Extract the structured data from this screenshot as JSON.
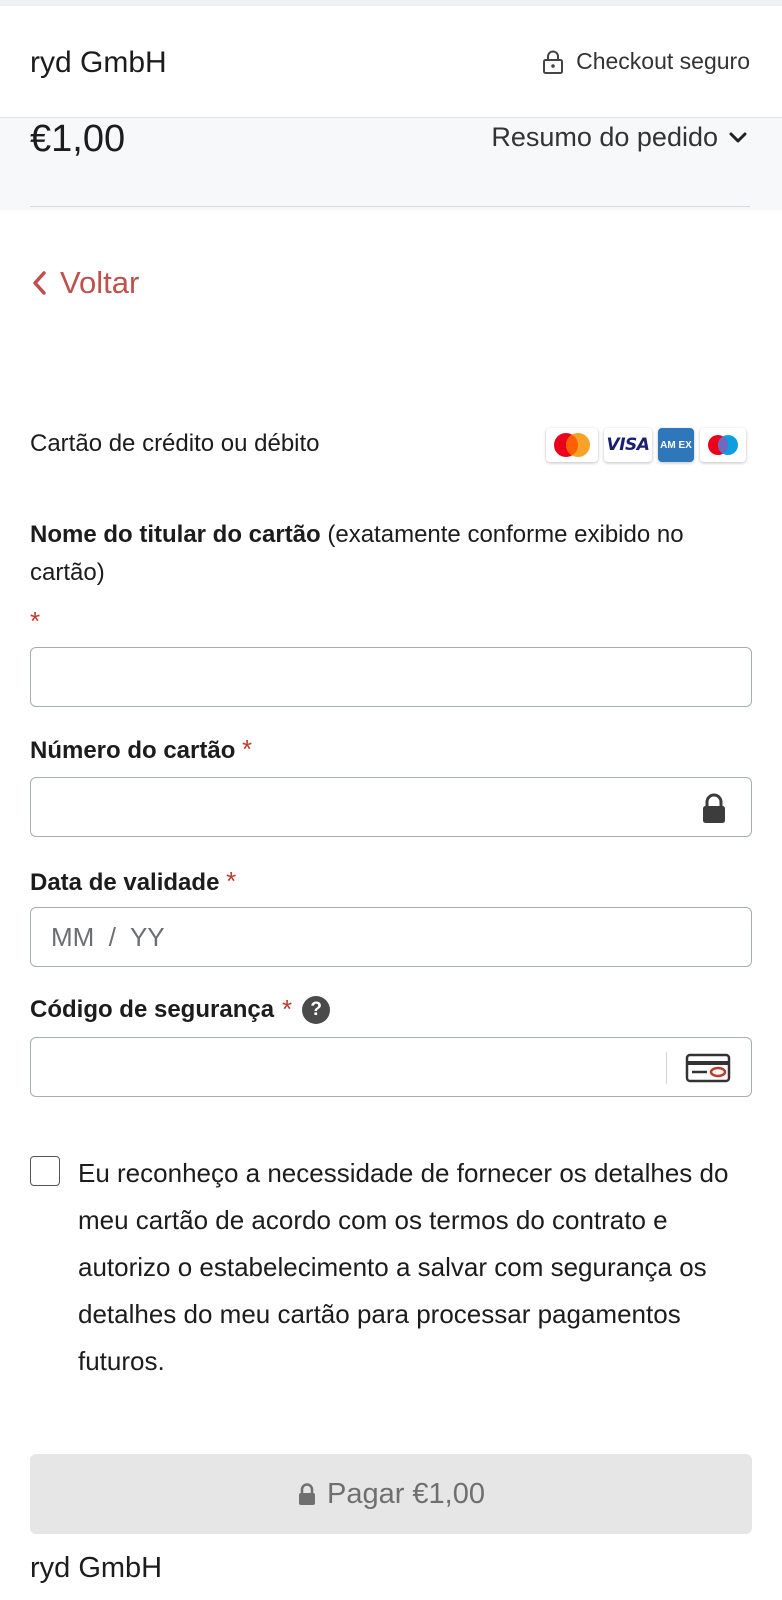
{
  "header": {
    "merchant": "ryd GmbH",
    "secure_label": "Checkout seguro"
  },
  "summary": {
    "amount": "€1,00",
    "toggle_label": "Resumo do pedido"
  },
  "nav": {
    "back_label": "Voltar"
  },
  "payment_method": {
    "title": "Cartão de crédito ou débito",
    "logos": [
      "mastercard",
      "visa",
      "amex",
      "maestro"
    ],
    "visa_text": "VISA",
    "amex_text": "AM EX"
  },
  "form": {
    "cardholder_label_bold": "Nome do titular do cartão",
    "cardholder_label_rest": " (exatamente conforme exibido no cartão)",
    "cardholder_value": "",
    "card_number_label": "Número do cartão",
    "card_number_value": "",
    "expiry_label": "Data de validade",
    "expiry_placeholder": "MM  /  YY",
    "security_label": "Código de segurança",
    "security_value": "",
    "help_glyph": "?",
    "required_mark": "*"
  },
  "consent": {
    "checked": false,
    "text": "Eu reconheço a necessidade de fornecer os detalhes do meu cartão de acordo com os termos do contrato e autorizo o estabelecimento a salvar com segurança os detalhes do meu cartão para processar pagamentos futuros."
  },
  "pay_button": {
    "label": "Pagar €1,00",
    "enabled": false
  },
  "footer": {
    "merchant": "ryd GmbH"
  },
  "colors": {
    "accent_red": "#c0504d",
    "required_red": "#c0392b",
    "summary_bg": "#f6f8fa",
    "disabled_button": "#e6e6e6"
  }
}
